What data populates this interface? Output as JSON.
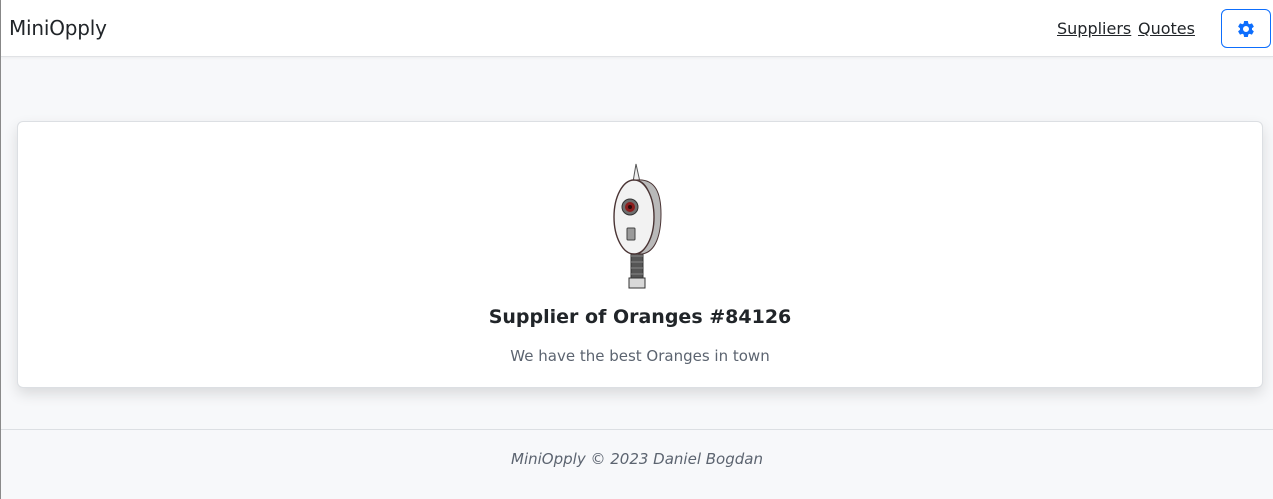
{
  "navbar": {
    "brand": "MiniOpply",
    "links": [
      {
        "label": "Suppliers"
      },
      {
        "label": "Quotes"
      }
    ],
    "settings_icon": "gear-icon",
    "accent_color": "#0d6efd"
  },
  "supplier_card": {
    "avatar_icon": "robot-avatar",
    "title": "Supplier of Oranges #84126",
    "description": "We have the best Oranges in town"
  },
  "footer": {
    "text": "MiniOpply © 2023 Daniel Bogdan"
  }
}
